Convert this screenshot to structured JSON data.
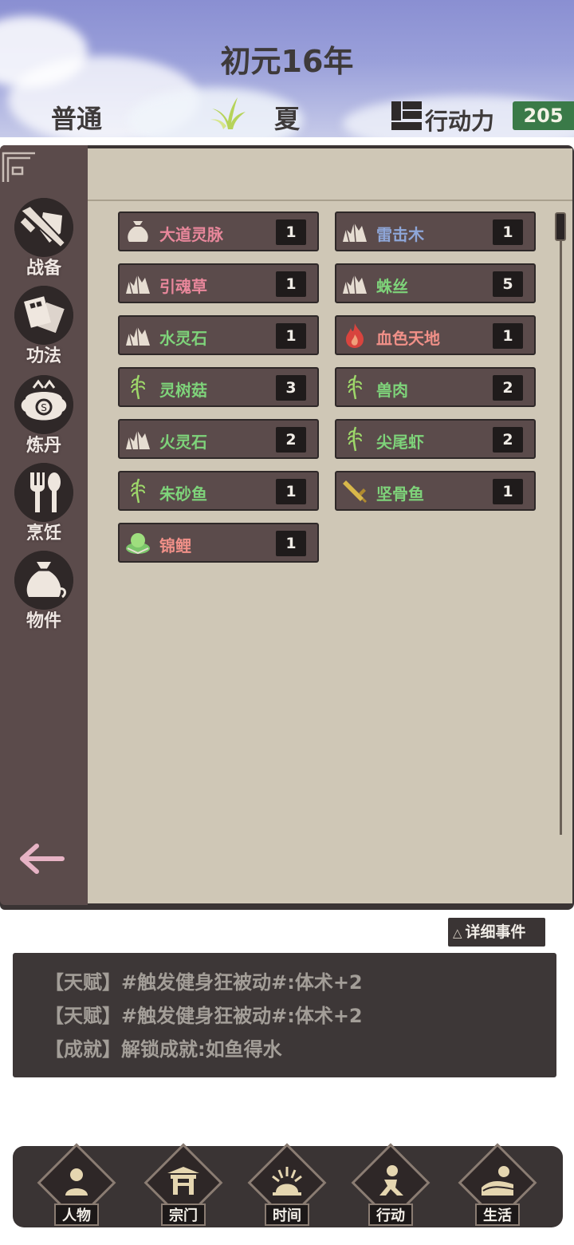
{
  "header": {
    "year": "初元16年",
    "difficulty": "普通",
    "season": "夏",
    "season_icon": "grass-sprout-icon",
    "action_points_label": "行动力",
    "action_points_icon": "blocks-icon",
    "action_points_value": "205"
  },
  "sidebar": {
    "items": [
      {
        "label": "战备",
        "icon": "sword-shield-icon"
      },
      {
        "label": "功法",
        "icon": "scroll-book-icon"
      },
      {
        "label": "炼丹",
        "icon": "cauldron-icon"
      },
      {
        "label": "烹饪",
        "icon": "fork-spoon-icon"
      },
      {
        "label": "物件",
        "icon": "pouch-icon"
      }
    ],
    "back_icon": "back-arrow-icon"
  },
  "inventory": {
    "items": [
      {
        "name": "大道灵脉",
        "count": "1",
        "icon": "pouch-icon",
        "color": "#e8879b"
      },
      {
        "name": "雷击木",
        "count": "1",
        "icon": "ore-icon",
        "color": "#8ea6d8"
      },
      {
        "name": "引魂草",
        "count": "1",
        "icon": "ore-icon",
        "color": "#e8879b"
      },
      {
        "name": "蛛丝",
        "count": "5",
        "icon": "ore-icon",
        "color": "#7ed37a"
      },
      {
        "name": "水灵石",
        "count": "1",
        "icon": "ore-icon",
        "color": "#7ed37a"
      },
      {
        "name": "血色天地",
        "count": "1",
        "icon": "flame-icon",
        "color": "#f09088"
      },
      {
        "name": "灵树菇",
        "count": "3",
        "icon": "herb-icon",
        "color": "#7ed37a"
      },
      {
        "name": "兽肉",
        "count": "2",
        "icon": "herb-icon",
        "color": "#7ed37a"
      },
      {
        "name": "火灵石",
        "count": "2",
        "icon": "ore-icon",
        "color": "#7ed37a"
      },
      {
        "name": "尖尾虾",
        "count": "2",
        "icon": "herb-icon",
        "color": "#7ed37a"
      },
      {
        "name": "朱砂鱼",
        "count": "1",
        "icon": "herb-icon",
        "color": "#7ed37a"
      },
      {
        "name": "坚骨鱼",
        "count": "1",
        "icon": "sword-icon",
        "color": "#7ed37a"
      },
      {
        "name": "锦鲤",
        "count": "1",
        "icon": "jade-stone-icon",
        "color": "#f09088"
      }
    ]
  },
  "events": {
    "detail_button": "详细事件",
    "lines": [
      "【天赋】#触发健身狂被动#:体术+2",
      "【天赋】#触发健身狂被动#:体术+2",
      "【成就】解锁成就:如鱼得水"
    ]
  },
  "bottom_nav": {
    "items": [
      {
        "label": "人物",
        "icon": "person-icon"
      },
      {
        "label": "宗门",
        "icon": "gate-icon"
      },
      {
        "label": "时间",
        "icon": "sunrise-icon"
      },
      {
        "label": "行动",
        "icon": "running-icon"
      },
      {
        "label": "生活",
        "icon": "landscape-icon"
      }
    ]
  }
}
